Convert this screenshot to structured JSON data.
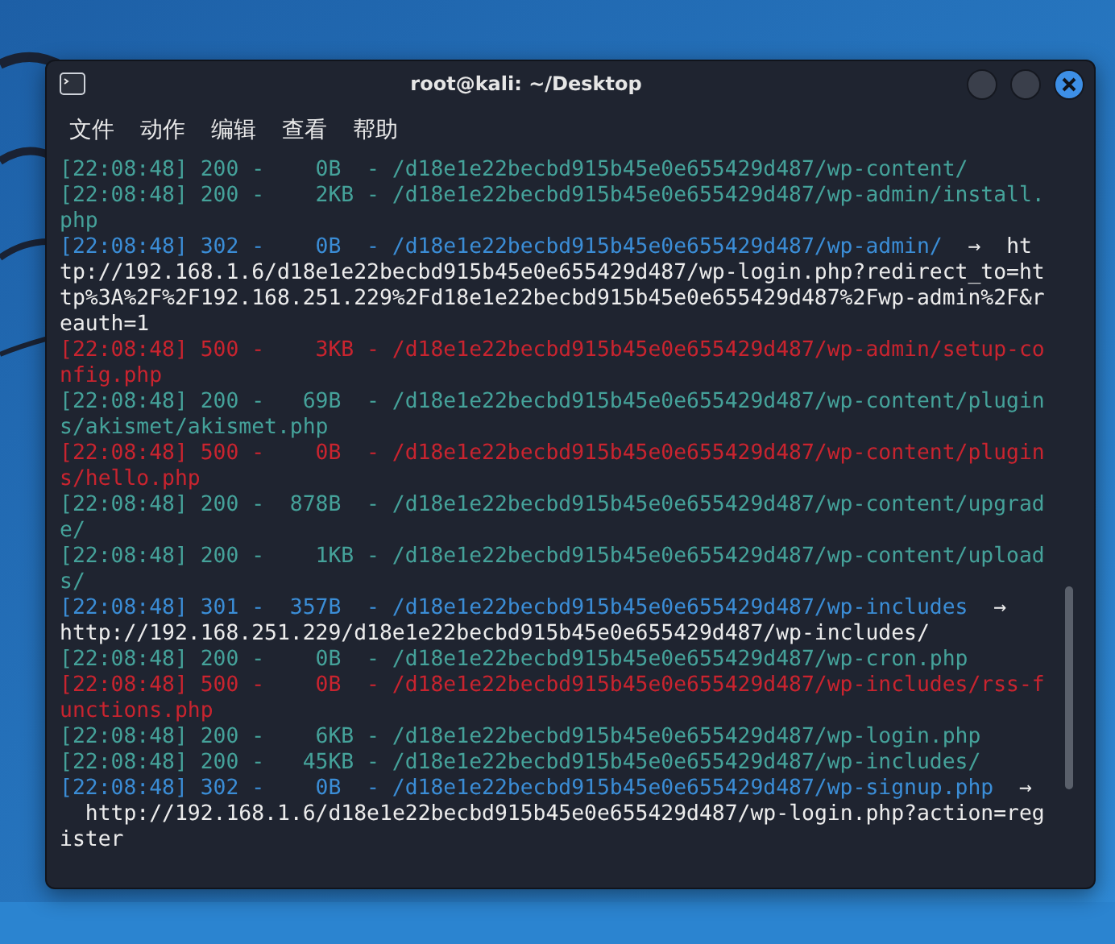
{
  "window": {
    "title": "root@kali: ~/Desktop"
  },
  "menu": [
    "文件",
    "动作",
    "编辑",
    "查看",
    "帮助"
  ],
  "log": [
    {
      "kind": "ok",
      "text": "[22:08:48] 200 -    0B  - /d18e1e22becbd915b45e0e655429d487/wp-content/"
    },
    {
      "kind": "ok",
      "text": "[22:08:48] 200 -    2KB - /d18e1e22becbd915b45e0e655429d487/wp-admin/install.php"
    },
    {
      "kind": "redirect",
      "text": "[22:08:48] 302 -    0B  - /d18e1e22becbd915b45e0e655429d487/wp-admin/",
      "arrow": "→",
      "target": "http://192.168.1.6/d18e1e22becbd915b45e0e655429d487/wp-login.php?redirect_to=http%3A%2F%2F192.168.251.229%2Fd18e1e22becbd915b45e0e655429d487%2Fwp-admin%2F&reauth=1"
    },
    {
      "kind": "error",
      "text": "[22:08:48] 500 -    3KB - /d18e1e22becbd915b45e0e655429d487/wp-admin/setup-config.php"
    },
    {
      "kind": "ok",
      "text": "[22:08:48] 200 -   69B  - /d18e1e22becbd915b45e0e655429d487/wp-content/plugins/akismet/akismet.php"
    },
    {
      "kind": "error",
      "text": "[22:08:48] 500 -    0B  - /d18e1e22becbd915b45e0e655429d487/wp-content/plugins/hello.php"
    },
    {
      "kind": "ok",
      "text": "[22:08:48] 200 -  878B  - /d18e1e22becbd915b45e0e655429d487/wp-content/upgrade/"
    },
    {
      "kind": "ok",
      "text": "[22:08:48] 200 -    1KB - /d18e1e22becbd915b45e0e655429d487/wp-content/uploads/"
    },
    {
      "kind": "redirect",
      "text": "[22:08:48] 301 -  357B  - /d18e1e22becbd915b45e0e655429d487/wp-includes",
      "arrow": "→",
      "target": "\nhttp://192.168.251.229/d18e1e22becbd915b45e0e655429d487/wp-includes/"
    },
    {
      "kind": "ok",
      "text": "[22:08:48] 200 -    0B  - /d18e1e22becbd915b45e0e655429d487/wp-cron.php"
    },
    {
      "kind": "error",
      "text": "[22:08:48] 500 -    0B  - /d18e1e22becbd915b45e0e655429d487/wp-includes/rss-functions.php"
    },
    {
      "kind": "ok",
      "text": "[22:08:48] 200 -    6KB - /d18e1e22becbd915b45e0e655429d487/wp-login.php"
    },
    {
      "kind": "ok",
      "text": "[22:08:48] 200 -   45KB - /d18e1e22becbd915b45e0e655429d487/wp-includes/"
    },
    {
      "kind": "redirect",
      "text": "[22:08:48] 302 -    0B  - /d18e1e22becbd915b45e0e655429d487/wp-signup.php",
      "arrow": "→",
      "target": "\n  http://192.168.1.6/d18e1e22becbd915b45e0e655429d487/wp-login.php?action=register"
    }
  ]
}
